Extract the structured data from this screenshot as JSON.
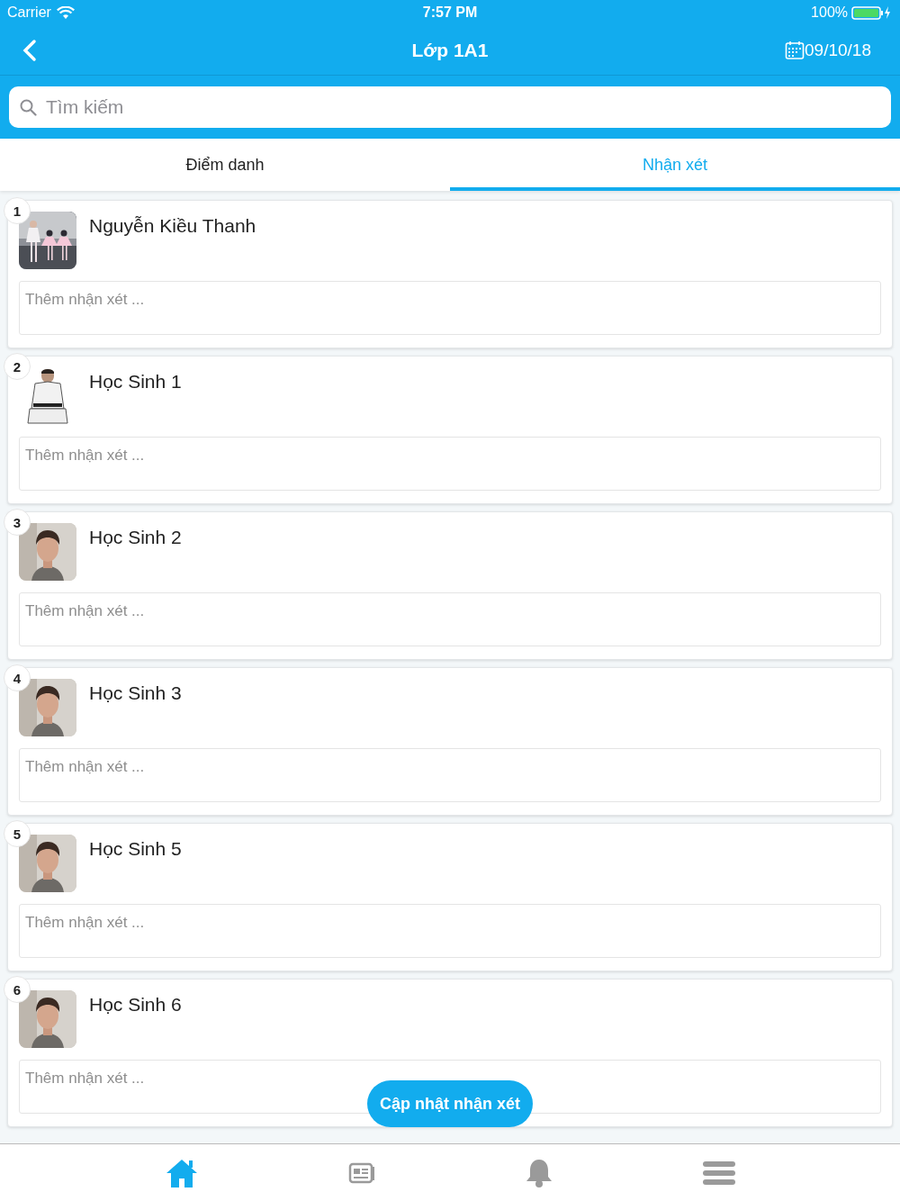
{
  "status_bar": {
    "carrier": "Carrier",
    "time": "7:57 PM",
    "battery": "100%"
  },
  "nav_bar": {
    "title": "Lớp 1A1",
    "date": "09/10/18"
  },
  "search": {
    "placeholder": "Tìm kiếm"
  },
  "tabs": [
    {
      "label": "Điểm danh",
      "selected": false
    },
    {
      "label": "Nhận xét",
      "selected": true
    }
  ],
  "students": [
    {
      "number": "1",
      "name": "Nguyễn Kiều Thanh",
      "comment_placeholder": "Thêm nhận xét ..."
    },
    {
      "number": "2",
      "name": "Học Sinh 1",
      "comment_placeholder": "Thêm nhận xét ..."
    },
    {
      "number": "3",
      "name": "Học Sinh 2",
      "comment_placeholder": "Thêm nhận xét ..."
    },
    {
      "number": "4",
      "name": "Học Sinh 3",
      "comment_placeholder": "Thêm nhận xét ..."
    },
    {
      "number": "5",
      "name": "Học Sinh 5",
      "comment_placeholder": "Thêm nhận xét ..."
    },
    {
      "number": "6",
      "name": "Học Sinh 6",
      "comment_placeholder": "Thêm nhận xét ..."
    }
  ],
  "update_button": "Cập nhật nhận xét",
  "bottom_nav": [
    {
      "kind": "home",
      "selected": true
    },
    {
      "kind": "news",
      "selected": false
    },
    {
      "kind": "bell",
      "selected": false
    },
    {
      "kind": "menu",
      "selected": false
    }
  ]
}
